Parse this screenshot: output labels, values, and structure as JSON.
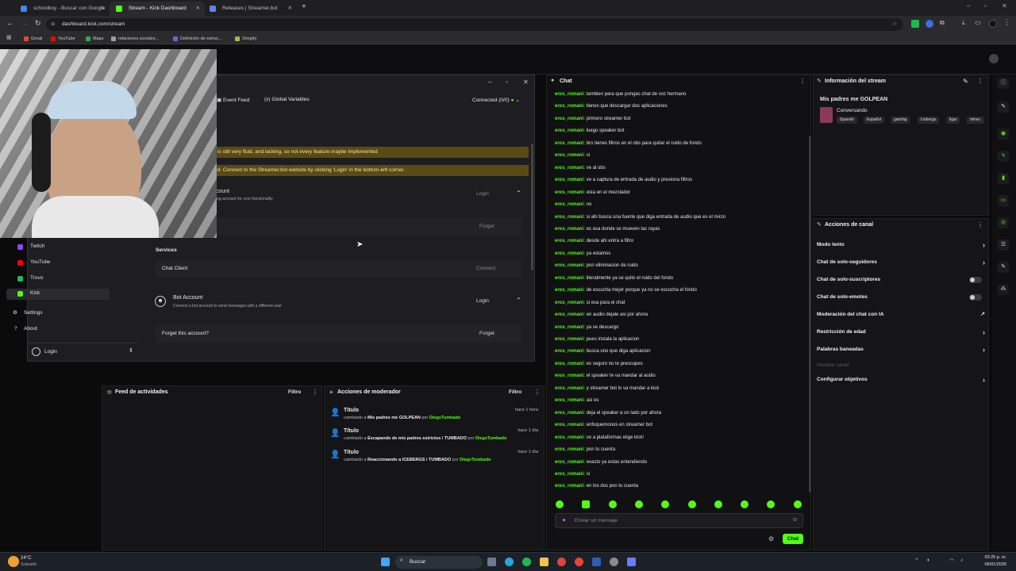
{
  "browser": {
    "tabs": [
      {
        "label": "schoolboy - Buscar con Google",
        "color": "#4285f4"
      },
      {
        "label": "Stream - Kick Dashboard",
        "color": "#53fc18"
      },
      {
        "label": "Releases | Streamer.bot",
        "color": "#6a7dff"
      }
    ],
    "url": "dashboard.kick.com/stream",
    "bookmarks": [
      {
        "label": "Gmail",
        "color": "#ea4335"
      },
      {
        "label": "YouTube",
        "color": "#ff0000"
      },
      {
        "label": "Maps",
        "color": "#34a853"
      },
      {
        "label": "relaciones sociales...",
        "color": "#9e9e9e"
      },
      {
        "label": "Definición de estruc...",
        "color": "#5f6bd8"
      },
      {
        "label": "Shopify",
        "color": "#95bf47"
      }
    ]
  },
  "streamerbot": {
    "tabs": {
      "event_feed": "Event Feed",
      "global_vars": "Global Variables"
    },
    "connected": "Connected (0/0)",
    "warnings": [
      "ementation is still very fluid, and lacking, so not every feature maybe implemented",
      "ent Required.  Connect to the Streamer.bot website by clicking 'Login' in the bottom-left corner."
    ],
    "account_title_partial": "count",
    "account_desc_partial": "ing account for core functionality",
    "login_label_1": "Login",
    "forget_label_1": "Forget",
    "services_title": "Services",
    "chat_client": "Chat Client",
    "connect_label": "Connect",
    "bot_account_title": "Bot Account",
    "bot_account_desc": "Connect a bot account to send messages with a different user",
    "login_label_2": "Login",
    "forget_account_q": "Forget this account?",
    "forget_label_2": "Forget",
    "nav": [
      {
        "label": "Twitch",
        "color": "#9146ff"
      },
      {
        "label": "YouTube",
        "color": "#ff0000"
      },
      {
        "label": "Trovo",
        "color": "#1db954"
      },
      {
        "label": "Kick",
        "color": "#53fc18"
      }
    ],
    "settings": "Settings",
    "about": "About",
    "login_footer": "Login"
  },
  "activity_feed": {
    "title": "Feed de actividades",
    "filter": "Filtro"
  },
  "mod_actions": {
    "title": "Acciones de moderador",
    "filter": "Filtro",
    "entries": [
      {
        "title": "Título",
        "time": "hace 1 hora",
        "pre": "cambiado a",
        "value": "Mis padres me GOLPEAN",
        "by": "por",
        "user": "DiegxTumbado"
      },
      {
        "title": "Título",
        "time": "hace 1 día",
        "pre": "cambiado a",
        "value": "Escapando de mis padres estrictos / TUMBADO",
        "by": "por",
        "user": "DiegxTumbado"
      },
      {
        "title": "Título",
        "time": "hace 1 día",
        "pre": "cambiado a",
        "value": "Reaccionando a ICEBERGS / TUMBADO",
        "by": "por",
        "user": "DiegxTumbado"
      }
    ]
  },
  "chat": {
    "title": "Chat",
    "messages": [
      {
        "user": "eros_romani:",
        "text": "tambien para que pongas chat de voz hermano"
      },
      {
        "user": "eros_romani:",
        "text": "tienes que descargar dos aplicaciones"
      },
      {
        "user": "eros_romani:",
        "text": "primero streamer bot"
      },
      {
        "user": "eros_romani:",
        "text": "luego speaker bot"
      },
      {
        "user": "eros_romani:",
        "text": "bro tienes filtros en el obs para quitar el ruido de fondo"
      },
      {
        "user": "eros_romani:",
        "text": "si"
      },
      {
        "user": "eros_romani:",
        "text": "ve al obs"
      },
      {
        "user": "eros_romani:",
        "text": "ve a captura de entrada de audio y presiona filtros"
      },
      {
        "user": "eros_romani:",
        "text": "esta en el mezclador"
      },
      {
        "user": "eros_romani:",
        "text": "no"
      },
      {
        "user": "eros_romani:",
        "text": "si ahi busca una fuente que diga entrada de audio que es el micro"
      },
      {
        "user": "eros_romani:",
        "text": "es esa donde se mueven las rayas"
      },
      {
        "user": "eros_romani:",
        "text": "desde ahi entra a filtro"
      },
      {
        "user": "eros_romani:",
        "text": "ya estamos"
      },
      {
        "user": "eros_romani:",
        "text": "pon eliminacion de ruido"
      },
      {
        "user": "eros_romani:",
        "text": "literalmente ya se quito el ruido del fondo"
      },
      {
        "user": "eros_romani:",
        "text": "de escucha mejor porque ya no se escucha el fondo"
      },
      {
        "user": "eros_romani:",
        "text": "si esa para el chat"
      },
      {
        "user": "eros_romani:",
        "text": "en audio dejale asi por ahora"
      },
      {
        "user": "eros_romani:",
        "text": "ya se descargo"
      },
      {
        "user": "eros_romani:",
        "text": "pues instala la aplicacion"
      },
      {
        "user": "eros_romani:",
        "text": "busca uno que diga aplicacion"
      },
      {
        "user": "eros_romani:",
        "text": "es seguro no te preocupes"
      },
      {
        "user": "eros_romani:",
        "text": "el speaker te va mandar al audio"
      },
      {
        "user": "eros_romani:",
        "text": "y streamer bot lo va mandar a kick"
      },
      {
        "user": "eros_romani:",
        "text": "asi es"
      },
      {
        "user": "eros_romani:",
        "text": "deja el speaker a un lado por ahora"
      },
      {
        "user": "eros_romani:",
        "text": "enfoquemonos en streamer bot"
      },
      {
        "user": "eros_romani:",
        "text": "ve a plataformas elige kick!"
      },
      {
        "user": "eros_romani:",
        "text": "pon tu cuenta"
      },
      {
        "user": "eros_romani:",
        "text": "exacto ya estas entendiendo"
      },
      {
        "user": "eros_romani:",
        "text": "si"
      },
      {
        "user": "eros_romani:",
        "text": "en los dos pon tu cuenta"
      }
    ],
    "input_placeholder": "Enviar un mensaje",
    "send_label": "Chat"
  },
  "stream_info": {
    "title": "Información del stream",
    "stream_title": "Mis padres me GOLPEAN",
    "category": "Conversando",
    "tags": [
      "Spanish",
      "Español",
      "gaming",
      "Icebergs",
      "ligar",
      "minec"
    ]
  },
  "channel_actions": {
    "title": "Acciones de canal",
    "items": [
      {
        "label": "Modo lento",
        "kind": "chevron"
      },
      {
        "label": "Chat de solo-seguidores",
        "kind": "chevron"
      },
      {
        "label": "Chat de solo-suscriptores",
        "kind": "toggle"
      },
      {
        "label": "Chat de solo-emotes",
        "kind": "toggle"
      },
      {
        "label": "Moderación del chat con IA",
        "kind": "external"
      },
      {
        "label": "Restricción de edad",
        "kind": "chevron"
      },
      {
        "label": "Palabras baneadas",
        "kind": "chevron"
      },
      {
        "label": "Hostear canal",
        "kind": "disabled"
      },
      {
        "label": "Configurar objetivos",
        "kind": "chevron"
      }
    ]
  },
  "taskbar": {
    "weather_temp": "24°C",
    "weather_desc": "Soleado",
    "search": "Buscar",
    "time": "03:25 p. m.",
    "date": "06/01/2026"
  },
  "colors": {
    "kick_green": "#53fc18",
    "warning_bg": "#5a4a14"
  }
}
